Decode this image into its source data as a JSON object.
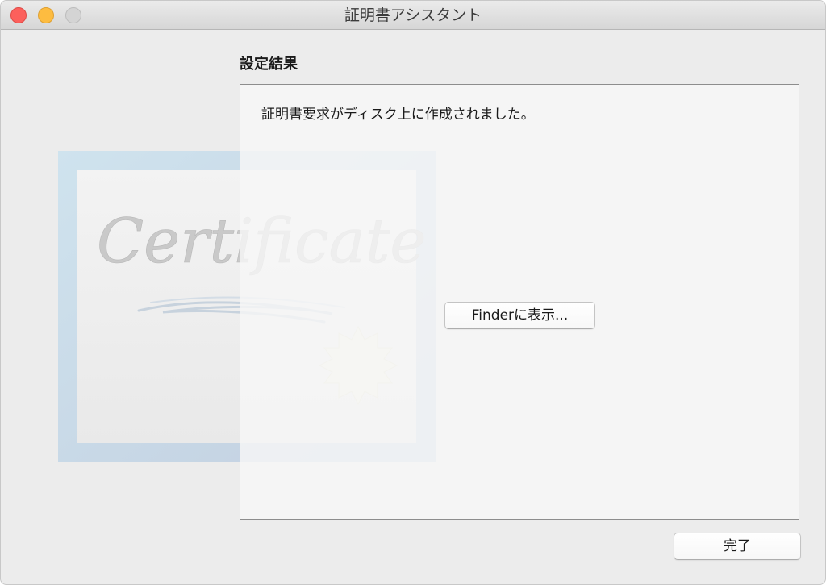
{
  "window": {
    "title": "証明書アシスタント"
  },
  "section": {
    "title": "設定結果"
  },
  "panel": {
    "message": "証明書要求がディスク上に作成されました。",
    "finder_button_label": "Finderに表示..."
  },
  "footer": {
    "done_button_label": "完了"
  },
  "artwork": {
    "certificate_text": "Certificate"
  },
  "colors": {
    "close": "#fc605c",
    "minimize": "#fdbc40",
    "zoom": "#d4d4d4",
    "window_background": "#ececec"
  }
}
